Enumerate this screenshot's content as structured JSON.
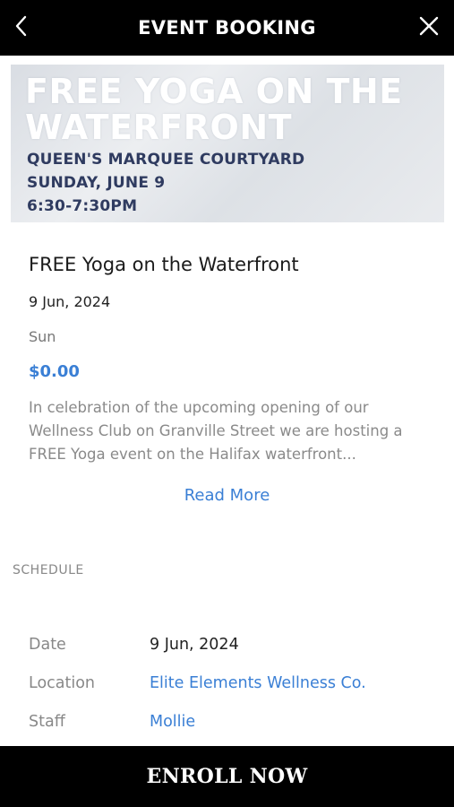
{
  "header": {
    "title": "EVENT BOOKING",
    "back_icon": "chevron-left-icon",
    "close_icon": "close-icon"
  },
  "banner": {
    "headline_line1": "FREE YOGA ON THE",
    "headline_line2": "WATERFRONT",
    "venue": "QUEEN'S MARQUEE COURTYARD",
    "date": "SUNDAY, JUNE 9",
    "time": "6:30-7:30PM"
  },
  "event": {
    "title": "FREE Yoga on the Waterfront",
    "date": "9 Jun, 2024",
    "day": "Sun",
    "price": "$0.00",
    "description": "In celebration of the upcoming opening of our Wellness Club on Granville Street we are hosting a FREE Yoga event on the Halifax waterfront...",
    "read_more": "Read More"
  },
  "schedule": {
    "section_label": "SCHEDULE",
    "rows": [
      {
        "label": "Date",
        "value": "9 Jun, 2024"
      },
      {
        "label": "Location",
        "value": "Elite Elements Wellness Co."
      },
      {
        "label": "Staff",
        "value": "Mollie"
      }
    ]
  },
  "footer": {
    "enroll_label": "ENROLL NOW"
  },
  "colors": {
    "bar": "#000000",
    "link": "#3a7fd5",
    "banner_text_dark": "#2f3b60"
  }
}
